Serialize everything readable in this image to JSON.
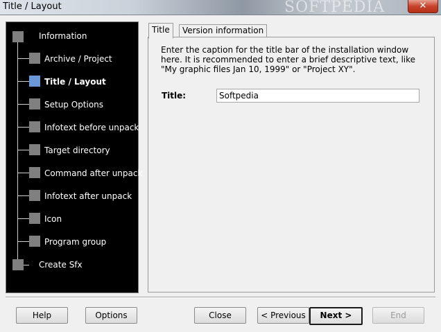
{
  "window": {
    "title": "Title / Layout",
    "watermark": "SOFTPEDIA",
    "close_glyph": "✕"
  },
  "nav": {
    "items": [
      {
        "label": "Information",
        "level": "top"
      },
      {
        "label": "Archive / Project",
        "level": "sub"
      },
      {
        "label": "Title / Layout",
        "level": "sub",
        "active": true
      },
      {
        "label": "Setup Options",
        "level": "sub"
      },
      {
        "label": "Infotext before unpack",
        "level": "sub"
      },
      {
        "label": "Target directory",
        "level": "sub"
      },
      {
        "label": "Command after unpack",
        "level": "sub"
      },
      {
        "label": "Infotext after unpack",
        "level": "sub"
      },
      {
        "label": "Icon",
        "level": "sub"
      },
      {
        "label": "Program group",
        "level": "sub"
      },
      {
        "label": "Create Sfx",
        "level": "top"
      }
    ],
    "active_color": "#6a98d8"
  },
  "tabs": [
    {
      "label": "Title",
      "active": true
    },
    {
      "label": "Version information",
      "active": false
    }
  ],
  "content": {
    "description": "Enter the caption for the title bar of the installation window here. It is recommended to enter a brief descriptive text, like \"My graphic files Jan 10, 1999\" or \"Project XY\".",
    "title_label": "Title:",
    "title_value": "Softpedia"
  },
  "buttons": {
    "help": "Help",
    "options": "Options",
    "close": "Close",
    "previous": "< Previous",
    "next": "Next >",
    "end": "End"
  }
}
